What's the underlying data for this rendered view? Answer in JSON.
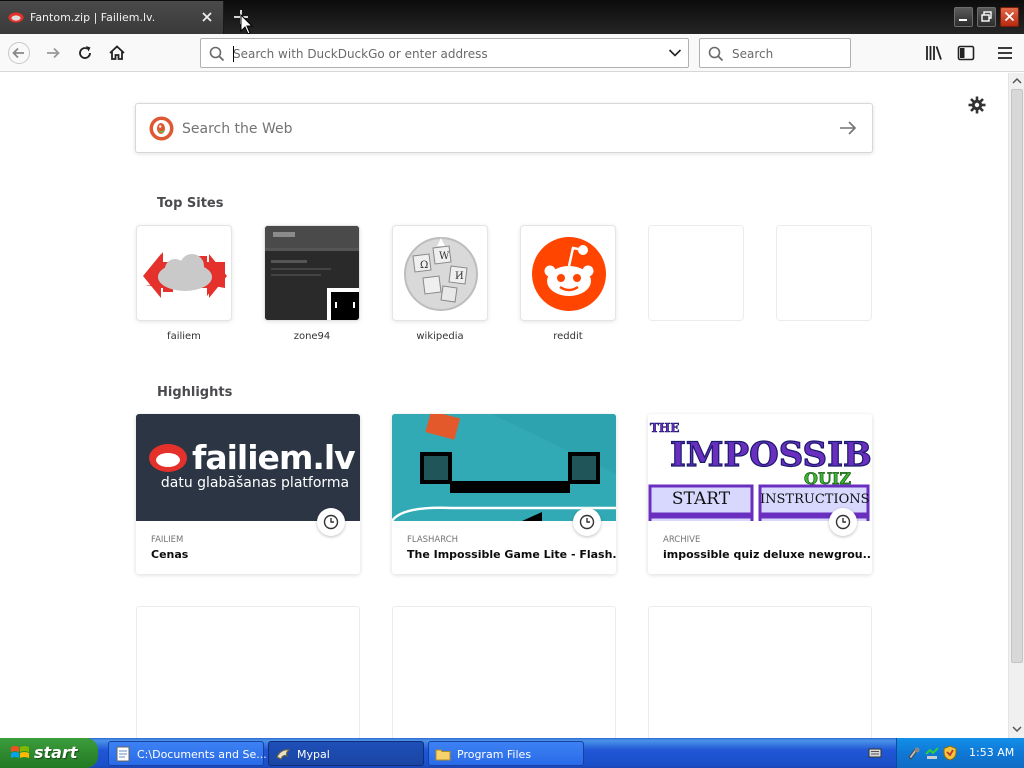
{
  "window": {
    "tab_title": "Fantom.zip | Failiem.lv."
  },
  "toolbar": {
    "url_placeholder": "Search with DuckDuckGo or enter address",
    "search_placeholder": "Search"
  },
  "newtab": {
    "websearch_placeholder": "Search the Web",
    "top_sites_heading": "Top Sites",
    "top_sites": [
      {
        "label": "failiem"
      },
      {
        "label": "zone94"
      },
      {
        "label": "wikipedia"
      },
      {
        "label": "reddit"
      },
      {
        "label": ""
      },
      {
        "label": ""
      }
    ],
    "highlights_heading": "Highlights",
    "highlights": [
      {
        "source": "FAILIEM",
        "title": "Cenas",
        "image_text": "failiem.lv",
        "image_subtext": "datu glabāšanas platforma"
      },
      {
        "source": "FLASHARCH",
        "title": "The Impossible Game Lite - Flash..."
      },
      {
        "source": "ARCHIVE",
        "title": "impossible quiz deluxe newgrou...",
        "image_buttons": [
          "START",
          "INSTRUCTIONS"
        ]
      }
    ]
  },
  "taskbar": {
    "start_label": "start",
    "tasks": [
      {
        "label": "C:\\Documents and Se..."
      },
      {
        "label": "Mypal"
      },
      {
        "label": "Program Files"
      }
    ],
    "clock": "1:53 AM"
  },
  "colors": {
    "reddit": "#ff4500",
    "failiem_dark": "#2b3544",
    "failiem_red": "#e5312b",
    "flash_teal": "#2aa0ac",
    "xp_blue": "#245edb",
    "xp_green": "#3c9d3c"
  }
}
